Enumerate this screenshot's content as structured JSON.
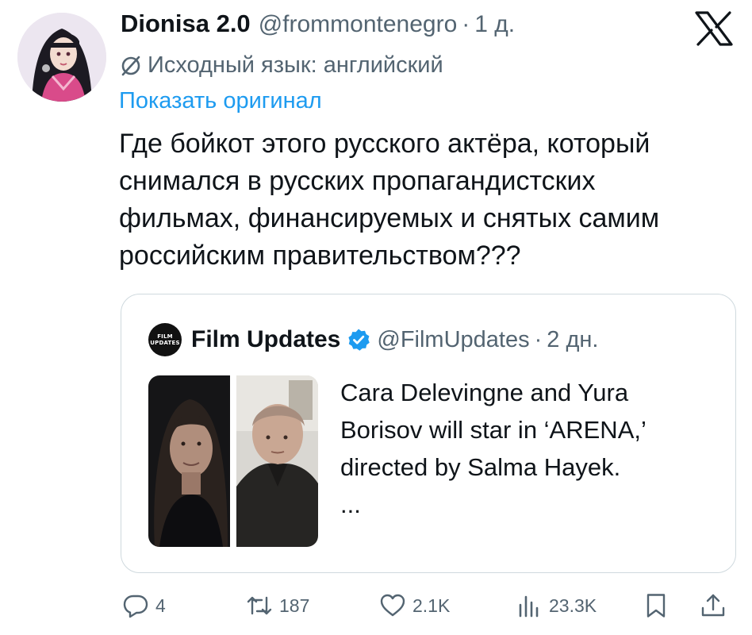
{
  "author": {
    "display_name": "Dionisa 2.0",
    "handle": "@frommontenegro",
    "separator": "·",
    "time": "1 д."
  },
  "translation": {
    "source_language_label": "Исходный язык: английский",
    "show_original_label": "Показать оригинал"
  },
  "tweet": {
    "lines": [
      "Где бойкот этого русского актёра, который",
      "снимался в русских пропагандистских",
      "фильмах, финансируемых и снятых самим",
      "российским правительством???"
    ]
  },
  "quote": {
    "avatar_text": [
      "FILM",
      "UPDATES"
    ],
    "display_name": "Film Updates",
    "handle": "@FilmUpdates",
    "separator": "·",
    "time": "2 дн.",
    "text_lines": [
      "Cara Delevingne and Yura",
      "Borisov will star in ‘ARENA,’",
      "directed by Salma Hayek.",
      "..."
    ]
  },
  "actions": {
    "replies": "4",
    "retweets": "187",
    "likes": "2.1K",
    "views": "23.3K"
  },
  "icons": {
    "brand": "x-logo-icon",
    "translate": "translate-slash-icon",
    "verified": "verified-badge-icon",
    "reply": "reply-icon",
    "retweet": "retweet-icon",
    "like": "heart-icon",
    "views": "views-chart-icon",
    "bookmark": "bookmark-icon",
    "share": "share-icon"
  },
  "colors": {
    "text": "#0f1419",
    "secondary": "#536471",
    "link": "#1d9bf0",
    "verified": "#1d9bf0",
    "border": "#cfd9de"
  }
}
